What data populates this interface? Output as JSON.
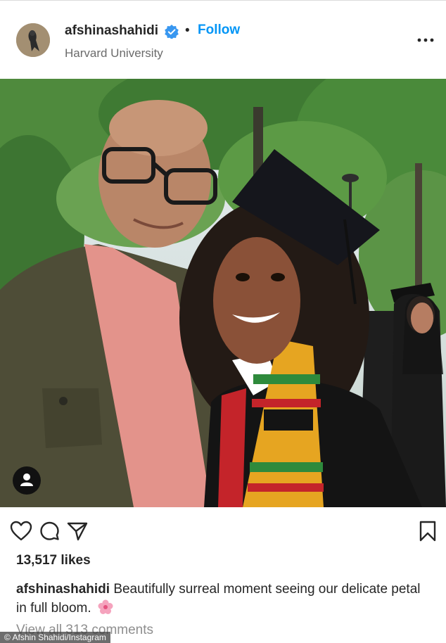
{
  "header": {
    "username": "afshinashahidi",
    "separator": "•",
    "follow_label": "Follow",
    "location": "Harvard University"
  },
  "icons": {
    "avatar": "profile-avatar",
    "verified": "verified-badge-icon",
    "more": "more-options-icon",
    "tagged_user": "tagged-user-icon",
    "like": "heart-icon",
    "comment": "comment-icon",
    "share": "share-icon",
    "save": "bookmark-icon"
  },
  "colors": {
    "follow": "#0095f6",
    "verified": "#3897f0",
    "text": "#262626",
    "muted": "#8e8e8e"
  },
  "post": {
    "likes": "13,517 likes",
    "caption_user": "afshinashahidi",
    "caption_text": "Beautifully surreal moment seeing our delicate petal in full bloom.",
    "view_comments": "View all 313 comments"
  },
  "credit": "© Afshin Shahidi/Instagram"
}
